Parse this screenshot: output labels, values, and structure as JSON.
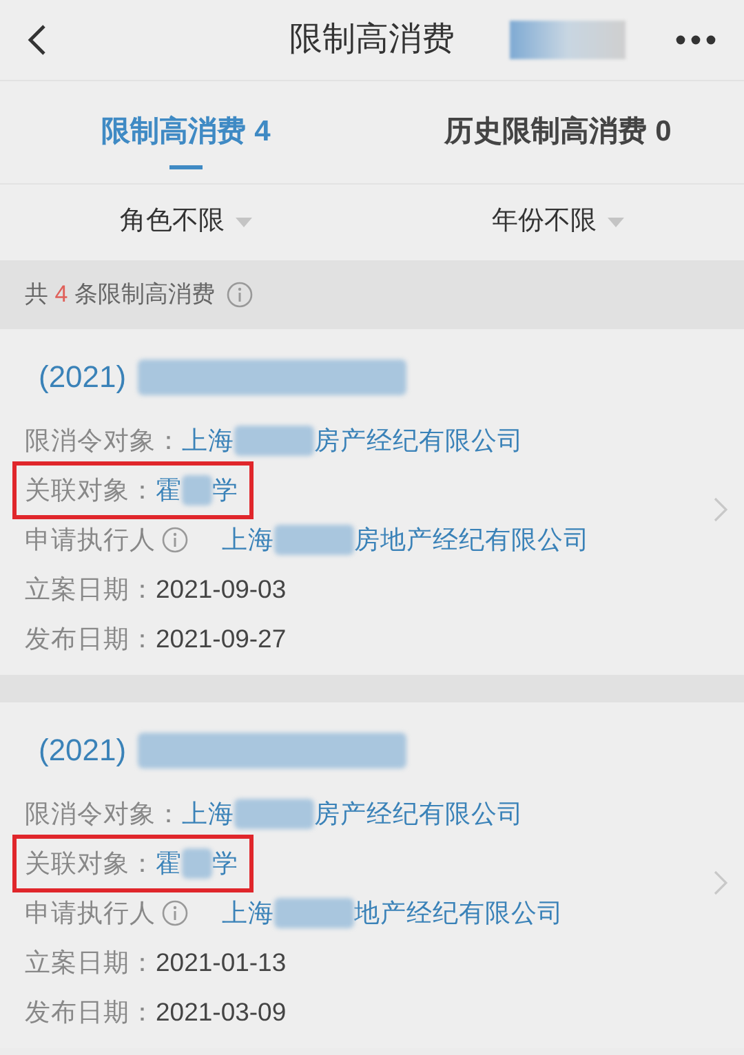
{
  "header": {
    "title": "限制高消费",
    "redacted": true
  },
  "tabs": [
    {
      "label": "限制高消费 4",
      "selected": true
    },
    {
      "label": "历史限制高消费 0",
      "selected": false
    }
  ],
  "filters": [
    {
      "label": "角色不限"
    },
    {
      "label": "年份不限"
    }
  ],
  "summary": {
    "before": "共",
    "count": "4",
    "after": "条限制高消费"
  },
  "cases": [
    {
      "case_prefix": "(2021)",
      "case_redacted": true,
      "fields": [
        {
          "kind": "link",
          "label": "限消令对象：",
          "value_before": "上海",
          "value_after": "房产经纪有限公司",
          "redacted": true,
          "highlighted": false
        },
        {
          "kind": "link",
          "label": "关联对象：",
          "value_before": "霍",
          "value_after": "学",
          "redacted": true,
          "highlighted": true
        },
        {
          "kind": "info",
          "label": "申请执行人",
          "value_before": "上海",
          "value_after": "房地产经纪有限公司",
          "redacted": true,
          "highlighted": false
        },
        {
          "kind": "plain",
          "label": "立案日期：",
          "value_before": "2021-09-03",
          "redacted": false,
          "highlighted": false
        },
        {
          "kind": "plain",
          "label": "发布日期：",
          "value_before": "2021-09-27",
          "redacted": false,
          "highlighted": false
        }
      ]
    },
    {
      "case_prefix": "(2021)",
      "case_redacted": true,
      "fields": [
        {
          "kind": "link",
          "label": "限消令对象：",
          "value_before": "上海",
          "value_after": "房产经纪有限公司",
          "redacted": true,
          "highlighted": false
        },
        {
          "kind": "link",
          "label": "关联对象：",
          "value_before": "霍",
          "value_after": "学",
          "redacted": true,
          "highlighted": true
        },
        {
          "kind": "info",
          "label": "申请执行人",
          "value_before": "上海",
          "value_after": "地产经纪有限公司",
          "redacted": true,
          "highlighted": false
        },
        {
          "kind": "plain",
          "label": "立案日期：",
          "value_before": "2021-01-13",
          "redacted": false,
          "highlighted": false
        },
        {
          "kind": "plain",
          "label": "发布日期：",
          "value_before": "2021-03-09",
          "redacted": false,
          "highlighted": false
        }
      ]
    }
  ]
}
